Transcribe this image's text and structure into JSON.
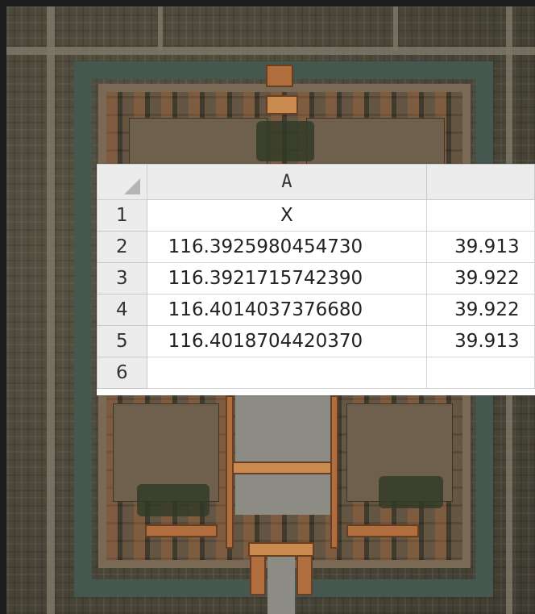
{
  "spreadsheet": {
    "column_headers": [
      "",
      "A",
      ""
    ],
    "rows": [
      {
        "row": "1",
        "cells": [
          "X",
          ""
        ]
      },
      {
        "row": "2",
        "cells": [
          "116.3925980454730",
          "39.913"
        ]
      },
      {
        "row": "3",
        "cells": [
          "116.3921715742390",
          "39.922"
        ]
      },
      {
        "row": "4",
        "cells": [
          "116.4014037376680",
          "39.922"
        ]
      },
      {
        "row": "5",
        "cells": [
          "116.4018704420370",
          "39.913"
        ]
      },
      {
        "row": "6",
        "cells": [
          "",
          ""
        ]
      }
    ]
  },
  "background": {
    "kind": "satellite-image",
    "colors": {
      "moat": "#46574f",
      "wall": "#7a6a55",
      "roof": "#b06e3e"
    }
  }
}
